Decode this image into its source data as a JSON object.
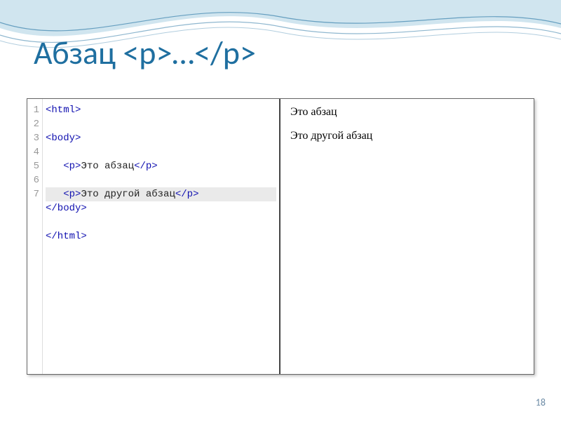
{
  "title": "Абзац  <p>…</p>",
  "page_number": "18",
  "code": {
    "line_numbers": [
      "1",
      "2",
      "3",
      "4",
      "5",
      "6",
      "7"
    ],
    "lines": [
      {
        "pre": "",
        "open": "<html>",
        "text": "",
        "close": "",
        "hl": false
      },
      {
        "pre": "",
        "open": "<body>",
        "text": "",
        "close": "",
        "hl": false
      },
      {
        "pre": "   ",
        "open": "<p>",
        "text": "Это абзац",
        "close": "</p>",
        "hl": false
      },
      {
        "pre": "   ",
        "open": "<p>",
        "text": "Это другой абзац",
        "close": "</p>",
        "hl": true
      },
      {
        "pre": "",
        "open": "</body>",
        "text": "",
        "close": "",
        "hl": false
      },
      {
        "pre": "",
        "open": "</html>",
        "text": "",
        "close": "",
        "hl": false
      },
      {
        "pre": "",
        "open": "",
        "text": "",
        "close": "",
        "hl": false
      }
    ]
  },
  "preview": {
    "p1": "Это абзац",
    "p2": "Это другой абзац"
  }
}
